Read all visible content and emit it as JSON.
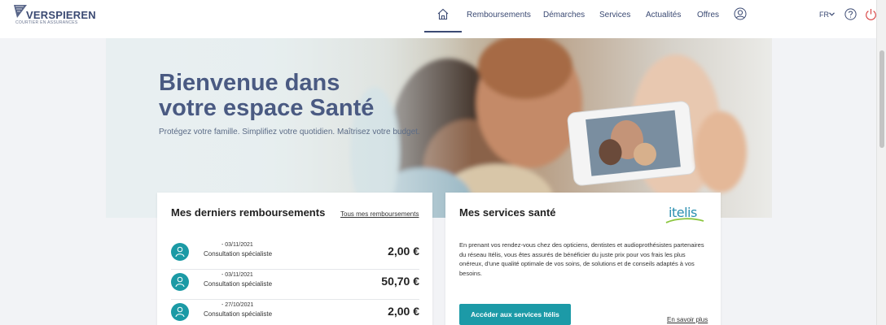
{
  "brand": {
    "name": "VERSPIEREN",
    "tagline": "COURTIER EN ASSURANCES"
  },
  "nav": {
    "items": [
      "Remboursements",
      "Démarches",
      "Services",
      "Actualités",
      "Offres"
    ],
    "language": "FR"
  },
  "hero": {
    "title_line1": "Bienvenue dans",
    "title_line2": "votre espace Santé",
    "subtitle": "Protégez votre famille. Simplifiez votre quotidien. Maîtrisez votre budget."
  },
  "reimbursements": {
    "title": "Mes derniers remboursements",
    "all_link": "Tous mes remboursements",
    "rows": [
      {
        "date": "- 03/11/2021",
        "label": "Consultation spécialiste",
        "amount": "2,00 €"
      },
      {
        "date": "- 03/11/2021",
        "label": "Consultation spécialiste",
        "amount": "50,70 €"
      },
      {
        "date": "- 27/10/2021",
        "label": "Consultation spécialiste",
        "amount": "2,00 €"
      }
    ]
  },
  "services": {
    "title": "Mes services santé",
    "partner_logo": "itelis",
    "description": "En prenant vos rendez-vous chez des opticiens, dentistes et audioprothésistes partenaires du réseau Itélis, vous êtes assurés de bénéficier du juste prix pour vos frais les plus onéreux, d'une qualité optimale de vos soins, de solutions et de conseils adaptés à vos besoins.",
    "cta": "Accéder aux services Itélis",
    "more_link": "En savoir plus"
  },
  "colors": {
    "brand": "#3b4a73",
    "accent": "#1c9aa7"
  },
  "icons": [
    "home-icon",
    "user-circle-icon",
    "chevron-down-icon",
    "help-icon",
    "power-icon",
    "person-icon"
  ]
}
